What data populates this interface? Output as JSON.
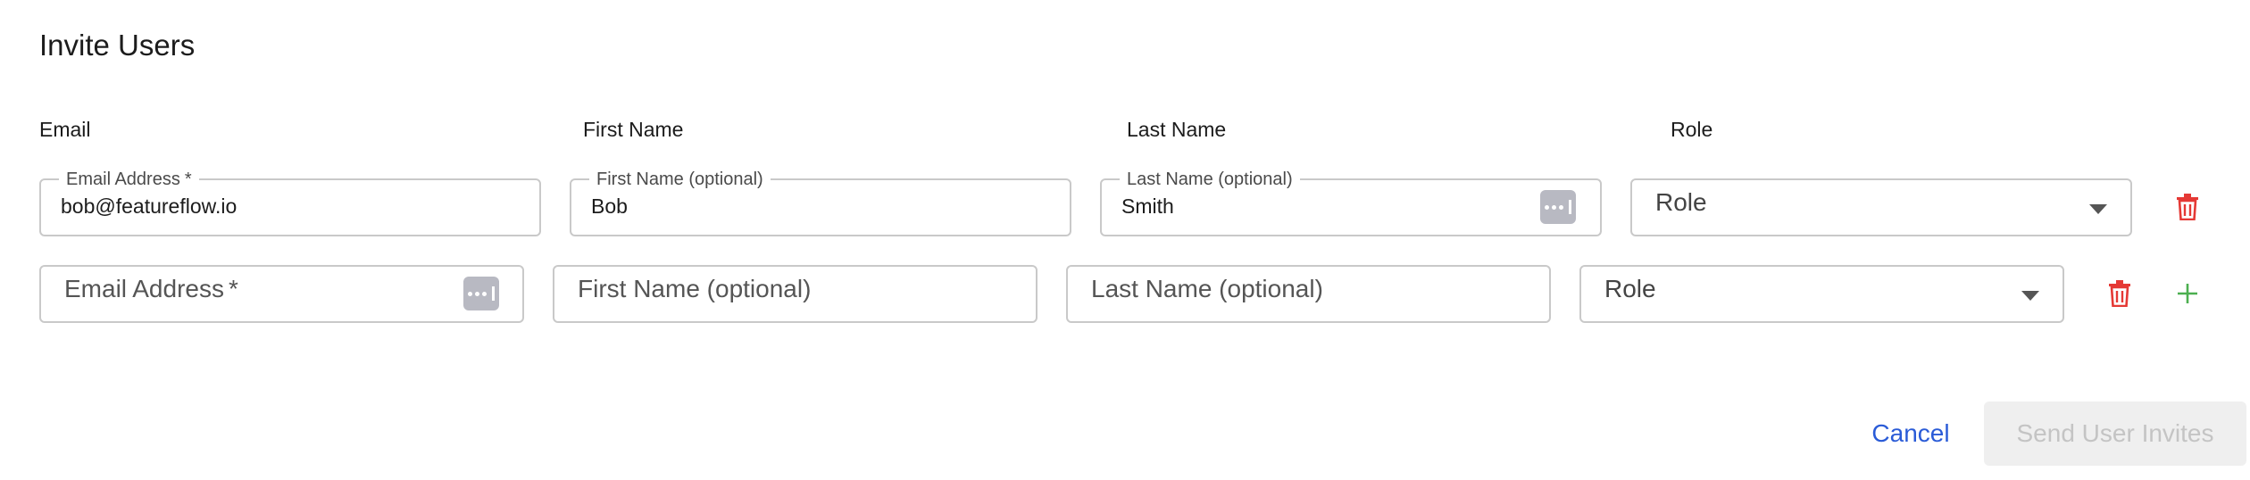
{
  "dialog": {
    "title": "Invite Users"
  },
  "columns": {
    "email": "Email",
    "first_name": "First Name",
    "last_name": "Last Name",
    "role": "Role"
  },
  "rows": [
    {
      "email_label": "Email Address",
      "email_required": "*",
      "email_value": "bob@featureflow.io",
      "first_name_label": "First Name (optional)",
      "first_name_value": "Bob",
      "last_name_label": "Last Name (optional)",
      "last_name_value": "Smith",
      "role_value": "Role"
    },
    {
      "email_placeholder": "Email Address",
      "email_required": "*",
      "first_name_placeholder": "First Name (optional)",
      "last_name_placeholder": "Last Name (optional)",
      "role_value": "Role"
    }
  ],
  "icons": {
    "delete": "trash-icon",
    "add": "plus-icon",
    "password_manager": "password-manager-icon",
    "dropdown": "chevron-down-icon"
  },
  "colors": {
    "delete": "#e53935",
    "add": "#4caf50",
    "link": "#2a5bd7",
    "pw_icon_bg": "#b8b9c2"
  },
  "actions": {
    "cancel_label": "Cancel",
    "send_label": "Send User Invites"
  }
}
